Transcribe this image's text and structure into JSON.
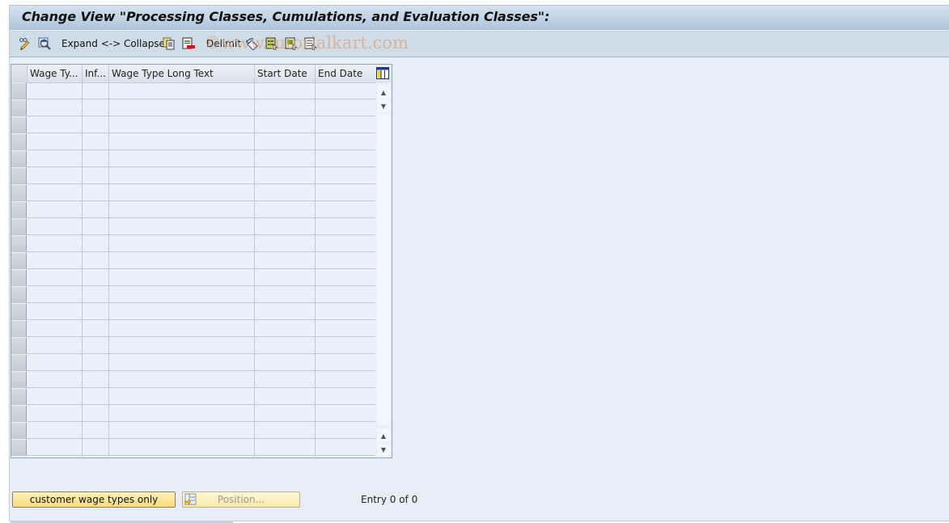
{
  "window": {
    "title": "Change View \"Processing Classes, Cumulations, and Evaluation Classes\":"
  },
  "toolbar": {
    "items": [
      {
        "icon": "display-change-icon",
        "label": ""
      },
      {
        "icon": "details-icon",
        "label": ""
      },
      {
        "icon": "",
        "label": "Expand <-> Collapse"
      },
      {
        "icon": "copy-as-icon",
        "label": ""
      },
      {
        "icon": "delete-icon",
        "label": ""
      },
      {
        "icon": "",
        "label": "Delimit"
      },
      {
        "icon": "undo-change-icon",
        "label": ""
      },
      {
        "icon": "select-all-icon",
        "label": ""
      },
      {
        "icon": "select-block-icon",
        "label": ""
      },
      {
        "icon": "deselect-all-icon",
        "label": ""
      }
    ],
    "watermark": "©www.tutorialkart.com"
  },
  "table": {
    "columns": [
      {
        "key": "wage_type",
        "label": "Wage Ty..."
      },
      {
        "key": "infotype",
        "label": "Inf..."
      },
      {
        "key": "long_text",
        "label": "Wage Type Long Text"
      },
      {
        "key": "start_date",
        "label": "Start Date"
      },
      {
        "key": "end_date",
        "label": "End Date"
      }
    ],
    "rows": [],
    "visible_empty_rows": 22,
    "settings_icon": "table-settings-icon",
    "scrollbar": {
      "up_icon": "scroll-up-icon",
      "down_icon": "scroll-down-icon"
    }
  },
  "footer": {
    "customer_button_label": "customer wage types only",
    "position_button_label": "Position...",
    "entry_text": "Entry 0 of 0"
  },
  "colors": {
    "title_gradient_top": "#d6e3ef",
    "title_gradient_bottom": "#adc4db",
    "toolbar_bg": "#cfdde8",
    "body_bg": "#e8eef6",
    "primary_button": "#f8dc78"
  }
}
